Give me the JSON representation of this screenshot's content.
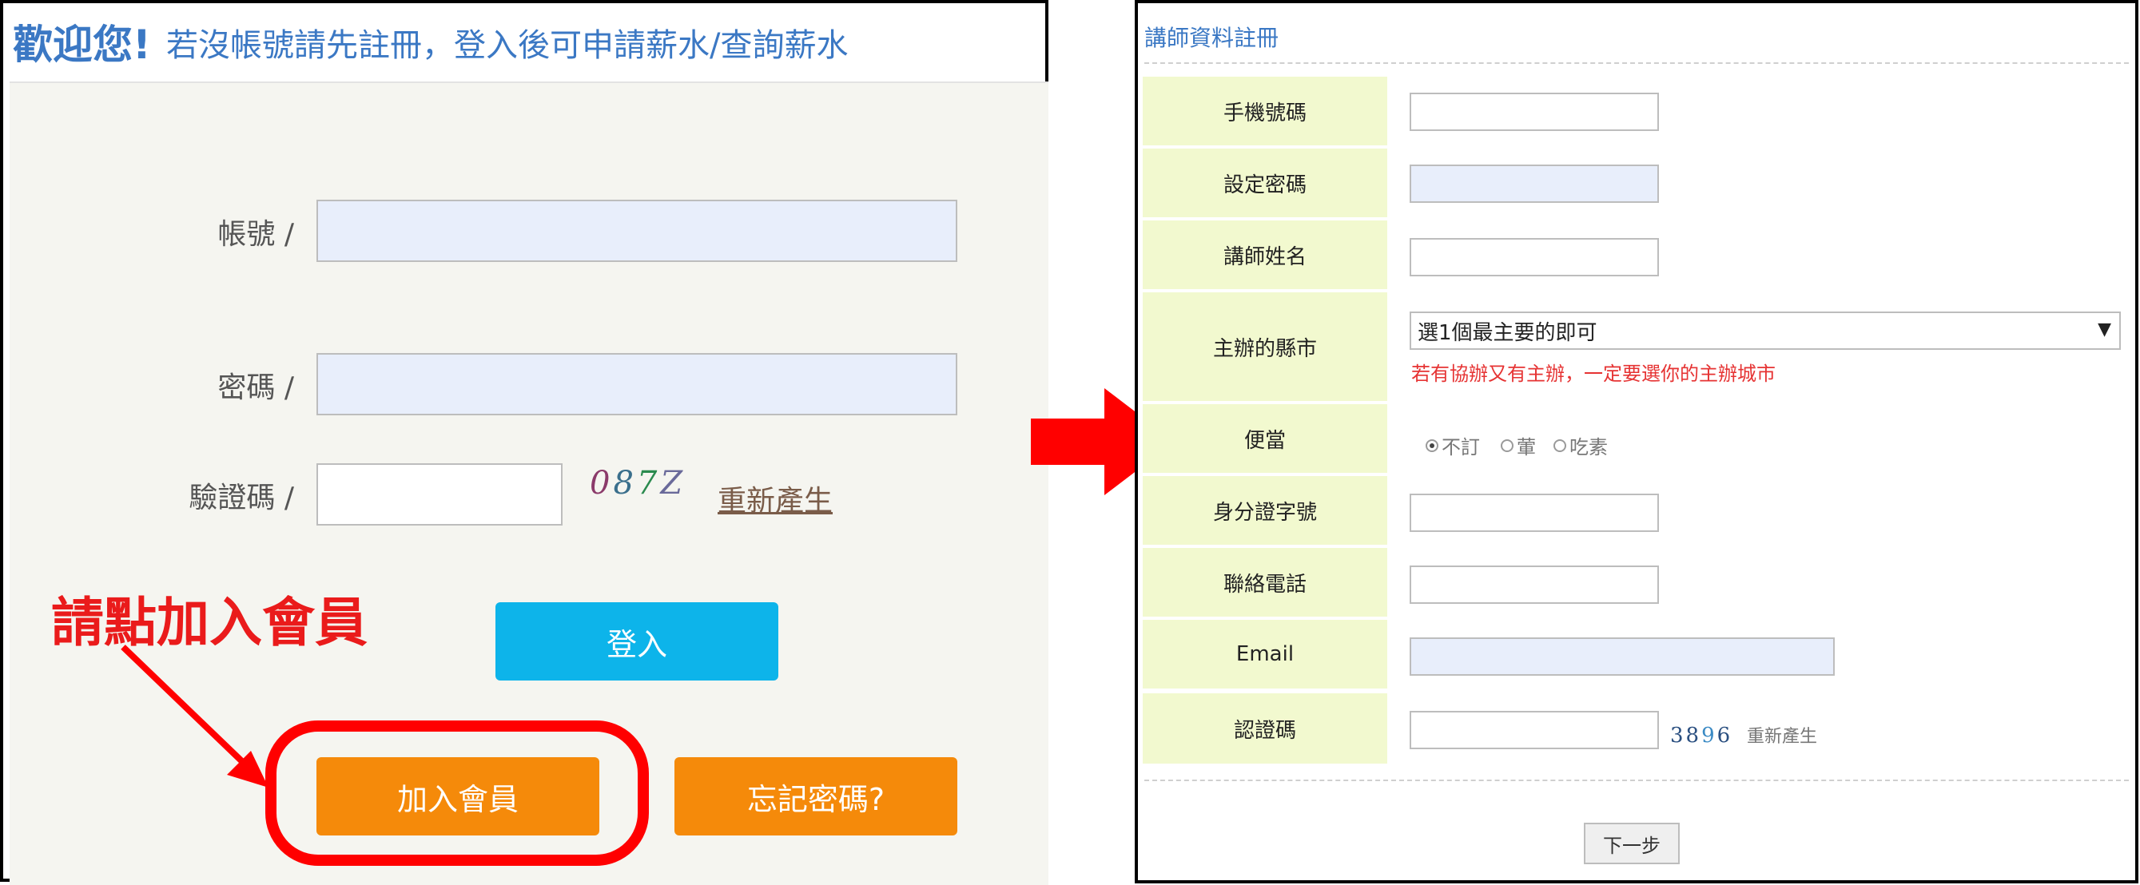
{
  "login_panel": {
    "welcome": "歡迎您!",
    "welcome_sub": "若沒帳號請先註冊，登入後可申請薪水/查詢薪水",
    "account_label": "帳號 /",
    "password_label": "密碼 /",
    "captcha_label": "驗證碼 /",
    "captcha_chars": [
      "0",
      "8",
      "7",
      "Z"
    ],
    "refresh_link": "重新產生",
    "login_button": "登入",
    "join_button": "加入會員",
    "forgot_button": "忘記密碼?"
  },
  "annotation": {
    "text": "請點加入會員",
    "color": "#ff0000"
  },
  "register_panel": {
    "title": "講師資料註冊",
    "fields": {
      "phone": "手機號碼",
      "password": "設定密碼",
      "name": "講師姓名",
      "city": "主辦的縣市",
      "bento": "便當",
      "id_number": "身分證字號",
      "contact_phone": "聯絡電話",
      "email": "Email",
      "captcha": "認證碼"
    },
    "city_select_value": "選1個最主要的即可",
    "city_hint": "若有協辦又有主辦，一定要選你的主辦城市",
    "bento_options": [
      "不訂",
      "葷",
      "吃素"
    ],
    "bento_selected": "不訂",
    "captcha_chars": [
      "3",
      "8",
      "9",
      "6"
    ],
    "refresh_link": "重新產生",
    "next_button": "下一步"
  },
  "colors": {
    "accent_blue": "#3b78c4",
    "login_button": "#0db4ea",
    "orange_button": "#f58a0a",
    "label_bg": "#f2f9cf",
    "hint_red": "#e63333"
  }
}
